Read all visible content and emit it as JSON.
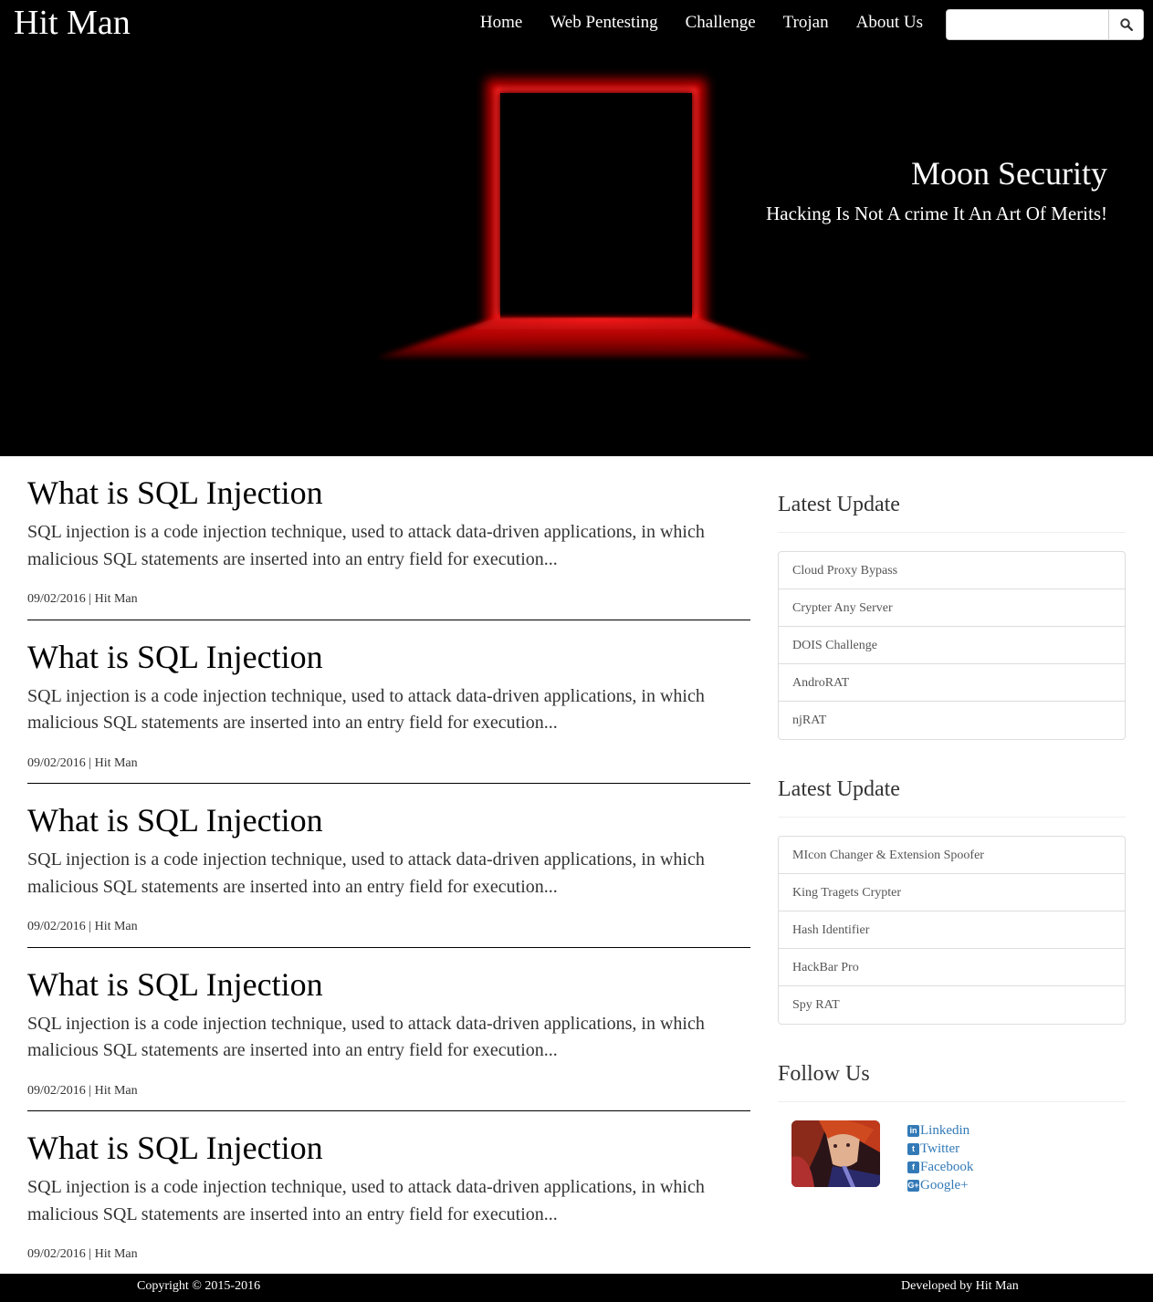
{
  "brand": "Hit Man",
  "nav": {
    "items": [
      "Home",
      "Web Pentesting",
      "Challenge",
      "Trojan",
      "About Us"
    ],
    "search_value": ""
  },
  "hero": {
    "title": "Moon Security",
    "subtitle": "Hacking Is Not A crime It An Art Of Merits!",
    "accent_color": "#ff0000"
  },
  "posts": [
    {
      "title": "What is SQL Injection",
      "body": "SQL injection is a code injection technique, used to attack data-driven applications, in which malicious SQL statements are inserted into an entry field for execution...",
      "meta": "09/02/2016 | Hit Man"
    },
    {
      "title": "What is SQL Injection",
      "body": "SQL injection is a code injection technique, used to attack data-driven applications, in which malicious SQL statements are inserted into an entry field for execution...",
      "meta": "09/02/2016 | Hit Man"
    },
    {
      "title": "What is SQL Injection",
      "body": "SQL injection is a code injection technique, used to attack data-driven applications, in which malicious SQL statements are inserted into an entry field for execution...",
      "meta": "09/02/2016 | Hit Man"
    },
    {
      "title": "What is SQL Injection",
      "body": "SQL injection is a code injection technique, used to attack data-driven applications, in which malicious SQL statements are inserted into an entry field for execution...",
      "meta": "09/02/2016 | Hit Man"
    },
    {
      "title": "What is SQL Injection",
      "body": "SQL injection is a code injection technique, used to attack data-driven applications, in which malicious SQL statements are inserted into an entry field for execution...",
      "meta": "09/02/2016 | Hit Man"
    }
  ],
  "sidebar": {
    "latest1": {
      "heading": "Latest Update",
      "items": [
        "Cloud Proxy Bypass",
        "Crypter Any Server",
        "DOIS Challenge",
        "AndroRAT",
        "njRAT"
      ]
    },
    "latest2": {
      "heading": "Latest Update",
      "items": [
        "MIcon Changer & Extension Spoofer",
        "King Tragets Crypter",
        "Hash Identifier",
        "HackBar Pro",
        "Spy RAT"
      ]
    },
    "follow": {
      "heading": "Follow Us",
      "links": [
        {
          "label": "Linkedin",
          "icon": "linkedin-icon",
          "glyph": "in"
        },
        {
          "label": "Twitter",
          "icon": "twitter-icon",
          "glyph": "t"
        },
        {
          "label": "Facebook",
          "icon": "facebook-icon",
          "glyph": "f"
        },
        {
          "label": "Google+",
          "icon": "google-plus-icon",
          "glyph": "G+"
        }
      ]
    }
  },
  "footer": {
    "copyright": "Copyright © 2015-2016",
    "developer": "Developed by Hit Man"
  }
}
